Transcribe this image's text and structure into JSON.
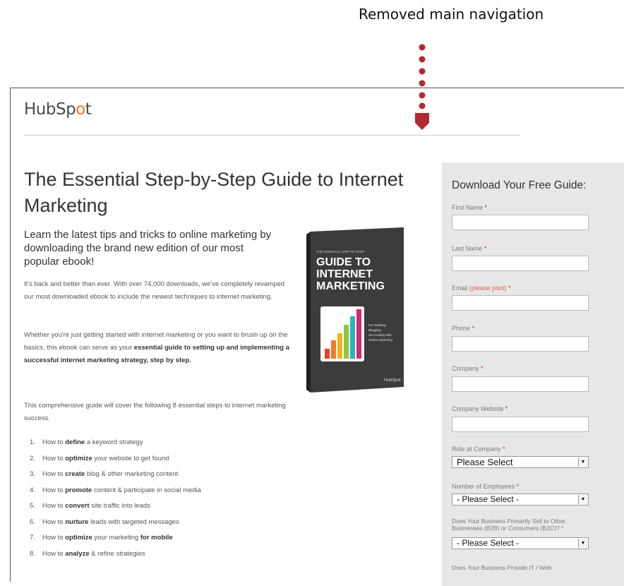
{
  "annotation": "Removed main navigation",
  "logo": {
    "text_a": "HubSp",
    "text_b": "o",
    "text_c": "t"
  },
  "hero": {
    "title": "The Essential Step-by-Step Guide to Internet Marketing",
    "lead": "Learn the latest tips and tricks to online marketing by downloading the brand new edition of our most popular ebook!",
    "para1": "It's back and better than ever. With over 74,000 downloads, we've completely revamped our most downloaded ebook to include the newest techniques to internet marketing.",
    "para2_a": "Whether you're just getting started with internet marketing or you want to brush up on the basics, this ebook can serve as your ",
    "para2_b": "essential guide to setting up and implementing a successful internet marketing strategy, step by step.",
    "para3": "This comprehensive guide will cover the following 8 essential steps to internet marketing success."
  },
  "book": {
    "kicker": "THE ESSENTIAL STEP-BY-STEP",
    "title_l1": "GUIDE TO",
    "title_l2": "INTERNET",
    "title_l3": "MARKETING",
    "sub_l1": "For Building,",
    "sub_l2": "Blogging,",
    "sub_l3": "Succeeding with",
    "sub_l4": "Online Marketing",
    "brand": "HubSpot",
    "bar_colors": [
      "#e8412a",
      "#f57722",
      "#f4b11b",
      "#8ec63f",
      "#2bb3c0",
      "#d7286d"
    ]
  },
  "steps": [
    {
      "num": "1.",
      "a": "How to ",
      "b": "define",
      "c": " a keyword strategy"
    },
    {
      "num": "2.",
      "a": "How to ",
      "b": "optimize",
      "c": " your website to get found"
    },
    {
      "num": "3.",
      "a": "How to ",
      "b": "create",
      "c": " blog & other marketing content"
    },
    {
      "num": "4.",
      "a": "How to ",
      "b": "promote",
      "c": " content & participate in social media"
    },
    {
      "num": "5.",
      "a": "How to ",
      "b": "convert",
      "c": " site traffic into leads"
    },
    {
      "num": "6.",
      "a": "How to ",
      "b": "nurture",
      "c": " leads with targeted messages"
    },
    {
      "num": "7.",
      "a": "How to ",
      "b": "optimize",
      "c": " your marketing ",
      "d": "for mobile"
    },
    {
      "num": "8.",
      "a": "How to ",
      "b": "analyze",
      "c": " & refine strategies"
    }
  ],
  "form": {
    "heading": "Download Your Free Guide:",
    "first_name": "First Name",
    "last_name": "Last Name",
    "email": "Email",
    "email_hint": "(please print)",
    "phone": "Phone",
    "company": "Company",
    "website": "Company Website",
    "role": "Role at Company",
    "role_value": "Please Select",
    "employees": "Number of Employees",
    "employees_value": "- Please Select -",
    "b2b": "Does Your Business Primarily Sell to Other Businesses (B2B) or Consumers (B2C)?",
    "b2b_value": "- Please Select -",
    "cut_label": "Does Your Business Provide IT / Web",
    "req": "*"
  }
}
